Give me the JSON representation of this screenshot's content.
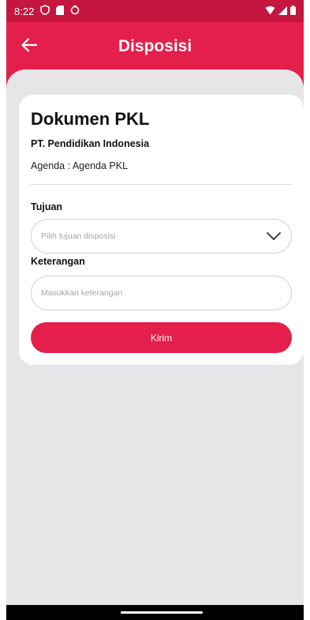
{
  "status_bar": {
    "time": "8:22",
    "icons_left": [
      "shield-icon",
      "sim-card-icon",
      "sync-icon"
    ],
    "icons_right": [
      "wifi-icon",
      "signal-icon",
      "battery-icon"
    ]
  },
  "app_bar": {
    "title": "Disposisi",
    "back_icon": "arrow-left-icon"
  },
  "document": {
    "title": "Dokumen PKL",
    "company": "PT. Pendidikan Indonesia",
    "agenda": "Agenda : Agenda PKL"
  },
  "form": {
    "tujuan_label": "Tujuan",
    "tujuan_placeholder": "Pilih tujuan disposisi",
    "keterangan_label": "Keterangan",
    "keterangan_placeholder": "Masukkan keterangan",
    "submit_label": "Kirim"
  },
  "colors": {
    "primary": "#e41f4b",
    "status_bar": "#c4163e",
    "background": "#e6e6e9",
    "card": "#ffffff"
  }
}
